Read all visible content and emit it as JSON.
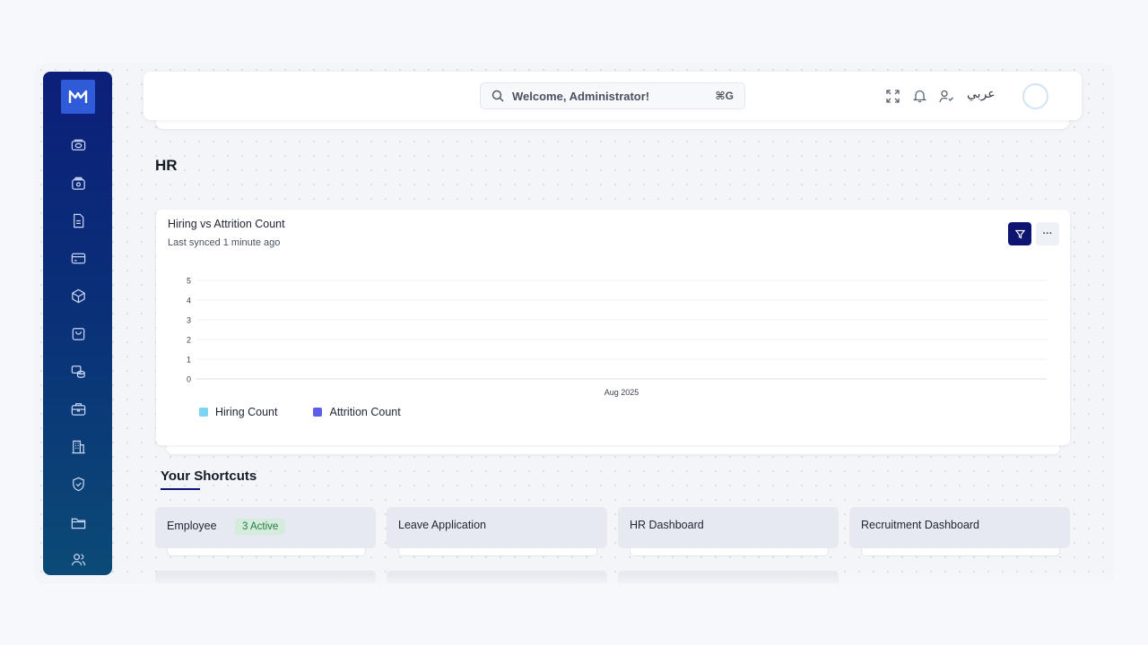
{
  "search": {
    "text": "Welcome, Administrator!",
    "shortcut": "⌘G"
  },
  "header": {
    "language_toggle": "عربي"
  },
  "page": {
    "title": "HR"
  },
  "sidebar": {
    "items": [
      {
        "icon": "dashboard-icon"
      },
      {
        "icon": "money-icon"
      },
      {
        "icon": "document-icon"
      },
      {
        "icon": "credit-card-icon"
      },
      {
        "icon": "cube-icon"
      },
      {
        "icon": "shopping-bag-icon"
      },
      {
        "icon": "database-icon"
      },
      {
        "icon": "briefcase-icon"
      },
      {
        "icon": "building-icon"
      },
      {
        "icon": "shield-check-icon"
      },
      {
        "icon": "folder-icon"
      },
      {
        "icon": "users-icon"
      }
    ]
  },
  "chart_card": {
    "title": "Hiring vs Attrition Count",
    "subtitle": "Last synced 1 minute ago",
    "more_label": "···"
  },
  "chart_data": {
    "type": "bar",
    "title": "Hiring vs Attrition Count",
    "categories": [
      "Aug 2025"
    ],
    "series": [
      {
        "name": "Hiring Count",
        "values": [
          0
        ],
        "color": "#7dd3f0"
      },
      {
        "name": "Attrition Count",
        "values": [
          0
        ],
        "color": "#5b5ee6"
      }
    ],
    "y_ticks": [
      "0",
      "1",
      "2",
      "3",
      "4",
      "5"
    ],
    "ylim": [
      0,
      5
    ],
    "grid": true,
    "legend": "bottom-left"
  },
  "shortcuts": {
    "title": "Your Shortcuts",
    "items": [
      {
        "label": "Employee",
        "badge": "3 Active"
      },
      {
        "label": "Leave Application"
      },
      {
        "label": "HR Dashboard"
      },
      {
        "label": "Recruitment Dashboard"
      }
    ]
  },
  "colors": {
    "sidebar_top": "#0c1f7a",
    "sidebar_bottom": "#0b4a76",
    "accent": "#0d1570",
    "badge_bg": "#d5ecdc",
    "badge_text": "#237a45"
  }
}
